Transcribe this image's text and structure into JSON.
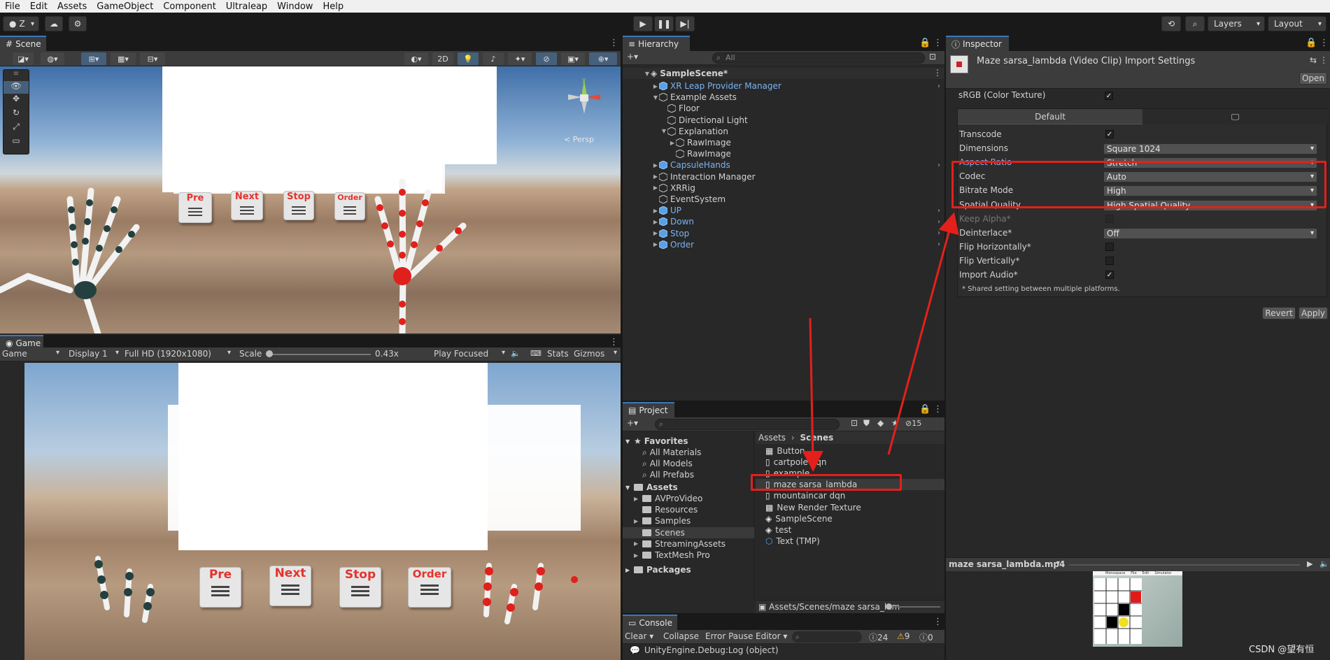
{
  "menu": [
    "File",
    "Edit",
    "Assets",
    "GameObject",
    "Component",
    "Ultraleap",
    "Window",
    "Help"
  ],
  "toolbar": {
    "account": "Z",
    "layers": "Layers",
    "layout": "Layout"
  },
  "scene_panel": {
    "tab": "Scene",
    "toggle_2d": "2D",
    "persp_label": "< Persp",
    "buttons": [
      "Pre",
      "Next",
      "Stop",
      "Order"
    ]
  },
  "game_panel": {
    "tab": "Game",
    "game_dropdown": "Game",
    "display": "Display 1",
    "resolution": "Full HD (1920x1080)",
    "scale_label": "Scale",
    "scale_value": "0.43x",
    "play_focused": "Play Focused",
    "stats": "Stats",
    "gizmos": "Gizmos",
    "buttons": [
      "Pre",
      "Next",
      "Stop",
      "Order"
    ]
  },
  "hierarchy": {
    "tab": "Hierarchy",
    "search_placeholder": "All",
    "scene_name": "SampleScene*",
    "items": [
      {
        "label": "XR Leap Provider Manager",
        "depth": 1,
        "blue": true,
        "arrow": "▶"
      },
      {
        "label": "Example Assets",
        "depth": 1,
        "blue": false,
        "arrow": "▼"
      },
      {
        "label": "Floor",
        "depth": 2,
        "blue": false,
        "arrow": ""
      },
      {
        "label": "Directional Light",
        "depth": 2,
        "blue": false,
        "arrow": ""
      },
      {
        "label": "Explanation",
        "depth": 2,
        "blue": false,
        "arrow": "▼"
      },
      {
        "label": "RawImage",
        "depth": 3,
        "blue": false,
        "arrow": "▶"
      },
      {
        "label": "RawImage",
        "depth": 3,
        "blue": false,
        "arrow": ""
      },
      {
        "label": "CapsuleHands",
        "depth": 1,
        "blue": true,
        "arrow": "▶"
      },
      {
        "label": "Interaction Manager",
        "depth": 1,
        "blue": false,
        "arrow": "▶"
      },
      {
        "label": "XRRig",
        "depth": 1,
        "blue": false,
        "arrow": "▶"
      },
      {
        "label": "EventSystem",
        "depth": 1,
        "blue": false,
        "arrow": ""
      },
      {
        "label": "UP",
        "depth": 1,
        "blue": true,
        "arrow": "▶"
      },
      {
        "label": "Down",
        "depth": 1,
        "blue": true,
        "arrow": "▶"
      },
      {
        "label": "Stop",
        "depth": 1,
        "blue": true,
        "arrow": "▶"
      },
      {
        "label": "Order",
        "depth": 1,
        "blue": true,
        "arrow": "▶"
      }
    ]
  },
  "inspector": {
    "tab": "Inspector",
    "title": "Maze sarsa_lambda (Video Clip) Import Settings",
    "open_button": "Open",
    "srgb_label": "sRGB (Color Texture)",
    "platform_default": "Default",
    "rows": [
      {
        "label": "Transcode",
        "type": "check",
        "checked": true,
        "highlight": false
      },
      {
        "label": "Dimensions",
        "type": "drop",
        "value": "Square 1024",
        "highlight": false
      },
      {
        "label": "Aspect Ratio",
        "type": "drop",
        "value": "Stretch",
        "highlight": true
      },
      {
        "label": "Codec",
        "type": "drop",
        "value": "Auto",
        "highlight": false
      },
      {
        "label": "Bitrate Mode",
        "type": "drop",
        "value": "High",
        "highlight": false
      },
      {
        "label": "Spatial Quality",
        "type": "drop",
        "value": "High Spatial Quality",
        "highlight": false
      },
      {
        "label": "Keep Alpha*",
        "type": "check",
        "checked": false,
        "disabled": true,
        "highlight": false
      },
      {
        "label": "Deinterlace*",
        "type": "drop",
        "value": "Off",
        "highlight": false
      },
      {
        "label": "Flip Horizontally*",
        "type": "check",
        "checked": false,
        "highlight": false
      },
      {
        "label": "Flip Vertically*",
        "type": "check",
        "checked": false,
        "highlight": false
      },
      {
        "label": "Import Audio*",
        "type": "check",
        "checked": true,
        "highlight": false
      }
    ],
    "note": "* Shared setting between multiple platforms.",
    "revert": "Revert",
    "apply": "Apply",
    "preview_title": "maze sarsa_lambda.mp4",
    "preview_menu": [
      "Monospace",
      "File",
      "Edit",
      "Simulator"
    ]
  },
  "project": {
    "tab": "Project",
    "count": "15",
    "favorites_label": "Favorites",
    "favorites": [
      "All Materials",
      "All Models",
      "All Prefabs"
    ],
    "assets_label": "Assets",
    "asset_folders": [
      "AVProVideo",
      "Resources",
      "Samples",
      "Scenes",
      "StreamingAssets",
      "TextMesh Pro"
    ],
    "packages_label": "Packages",
    "breadcrumb": [
      "Assets",
      "Scenes"
    ],
    "files": [
      {
        "name": "Button",
        "icon": "prefab"
      },
      {
        "name": "cartpole dqn",
        "icon": "video"
      },
      {
        "name": "example",
        "icon": "video"
      },
      {
        "name": "maze sarsa_lambda",
        "icon": "video"
      },
      {
        "name": "mountaincar dqn",
        "icon": "video"
      },
      {
        "name": "New Render Texture",
        "icon": "texture"
      },
      {
        "name": "SampleScene",
        "icon": "scene"
      },
      {
        "name": "test",
        "icon": "scene"
      },
      {
        "name": "Text (TMP)",
        "icon": "cube"
      }
    ],
    "path": "Assets/Scenes/maze sarsa_lam"
  },
  "console": {
    "tab": "Console",
    "clear": "Clear",
    "collapse": "Collapse",
    "error_pause": "Error Pause",
    "editor": "Editor",
    "info_count": "24",
    "warn_count": "9",
    "err_count": "0",
    "log_line": "UnityEngine.Debug:Log (object)"
  },
  "watermark": "CSDN @望有恒",
  "colors": {
    "accent": "#3a79bb",
    "highlight_red": "#e3201b",
    "prefab_blue": "#7bb2f2"
  }
}
